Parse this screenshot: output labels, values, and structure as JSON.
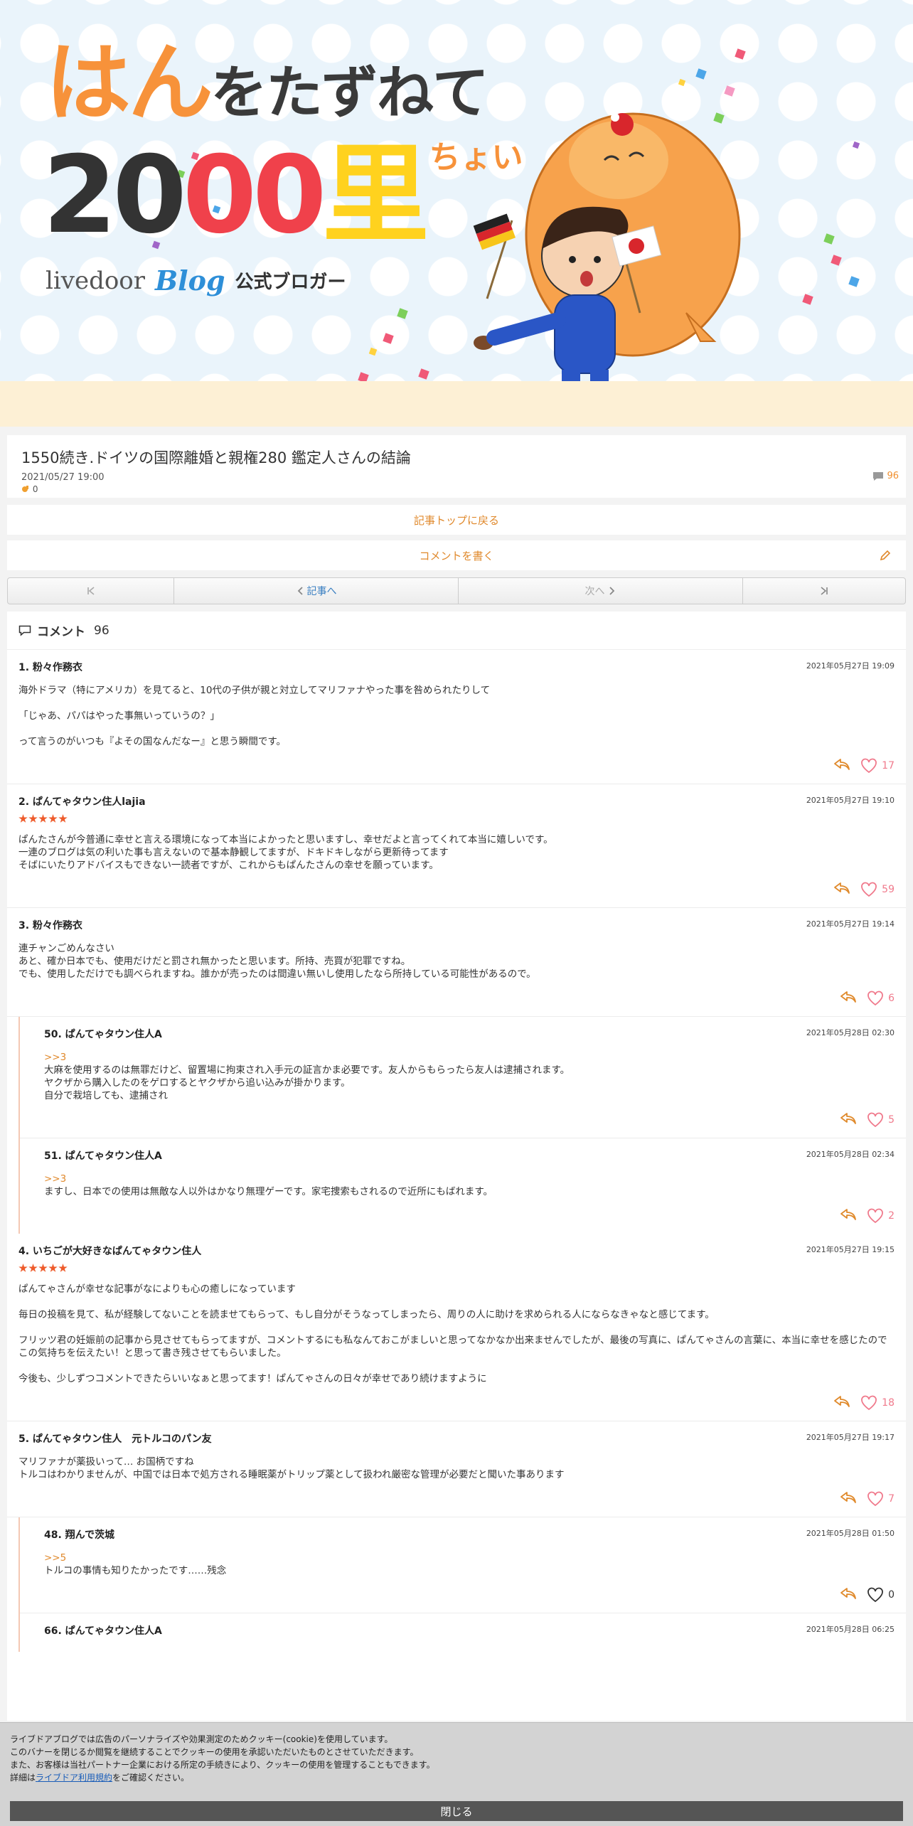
{
  "banner": {
    "title_a": "はん",
    "title_b": "をたずねて",
    "big_a": "20",
    "big_b": "00",
    "big_c": "里",
    "big_small": "ちょい",
    "logo_livedoor": "livedoor",
    "logo_blog": "Blog",
    "logo_official": "公式ブロガー"
  },
  "article": {
    "title": "1550続き.ドイツの国際離婚と親権280 鑑定人さんの結論",
    "date": "2021/05/27 19:00",
    "likes": "0",
    "comment_count": "96"
  },
  "links": {
    "back_to_top": "記事トップに戻る",
    "write_comment": "コメントを書く"
  },
  "pager": {
    "prev": "記事へ",
    "next": "次へ"
  },
  "comments_header": {
    "label": "コメント",
    "count": "96"
  },
  "comments": [
    {
      "name": "1.  粉々作務衣",
      "date": "2021年05月27日 19:09",
      "stars": false,
      "lines": [
        "海外ドラマ（特にアメリカ）を見てると、10代の子供が親と対立してマリファナやった事を咎められたりして",
        "",
        "「じゃあ、パパはやった事無いっていうの？」",
        "",
        "って言うのがいつも『よその国なんだなー』と思う瞬間です。"
      ],
      "likes": "17"
    },
    {
      "name": "2.  ぱんてゃタウン住人lajia",
      "date": "2021年05月27日 19:10",
      "stars": true,
      "lines": [
        "ぱんたさんが今普通に幸せと言える環境になって本当によかったと思いますし、幸せだよと言ってくれて本当に嬉しいです。",
        "一連のブログは気の利いた事も言えないので基本静観してますが、ドキドキしながら更新待ってます",
        "そばにいたりアドバイスもできない一読者ですが、これからもぱんたさんの幸せを願っています。"
      ],
      "likes": "59"
    },
    {
      "name": "3.  粉々作務衣",
      "date": "2021年05月27日 19:14",
      "stars": false,
      "lines": [
        "連チャンごめんなさい",
        "あと、確か日本でも、使用だけだと罰され無かったと思います。所持、売買が犯罪ですね。",
        "でも、使用しただけでも調べられますね。誰かが売ったのは間違い無いし使用したなら所持している可能性があるので。"
      ],
      "likes": "6",
      "replies": [
        {
          "name": "50.  ぱんてゃタウン住人A",
          "date": "2021年05月28日 02:30",
          "ref": ">>3",
          "lines": [
            "大麻を使用するのは無罪だけど、留置場に拘束され入手元の証言かま必要です。友人からもらったら友人は逮捕されます。",
            "ヤクザから購入したのをゲロするとヤクザから追い込みが掛かります。",
            "自分で栽培しても、逮捕され"
          ],
          "likes": "5"
        },
        {
          "name": "51.  ぱんてゃタウン住人A",
          "date": "2021年05月28日 02:34",
          "ref": ">>3",
          "lines": [
            "ますし、日本での使用は無敵な人以外はかなり無理ゲーです。家宅捜索もされるので近所にもばれます。"
          ],
          "likes": "2"
        }
      ]
    },
    {
      "name": "4.  いちごが大好きなぱんてゃタウン住人",
      "date": "2021年05月27日 19:15",
      "stars": true,
      "lines": [
        "ぱんてゃさんが幸せな記事がなによりも心の癒しになっています",
        "",
        "毎日の投稿を見て、私が経験してないことを読ませてもらって、もし自分がそうなってしまったら、周りの人に助けを求められる人にならなきゃなと感じてます。",
        "",
        "フリッツ君の妊娠前の記事から見させてもらってますが、コメントするにも私なんておこがましいと思ってなかなか出来ませんでしたが、最後の写真に、ぱんてゃさんの言葉に、本当に幸せを感じたのでこの気持ちを伝えたい！と思って書き残させてもらいました。",
        "",
        "今後も、少しずつコメントできたらいいなぁと思ってます！ぱんてゃさんの日々が幸せであり続けますように"
      ],
      "likes": "18"
    },
    {
      "name": "5.  ぱんてゃタウン住人　元トルコのパン友",
      "date": "2021年05月27日 19:17",
      "stars": false,
      "lines": [
        "マリファナが薬扱いって… お国柄ですね",
        "トルコはわかりませんが、中国では日本で処方される睡眠薬がトリップ薬として扱われ厳密な管理が必要だと聞いた事あります"
      ],
      "likes": "7",
      "replies": [
        {
          "name": "48.  翔んで茨城",
          "date": "2021年05月28日 01:50",
          "ref": ">>5",
          "lines": [
            "トルコの事情も知りたかったです……残念"
          ],
          "likes": "0",
          "zero": true
        },
        {
          "name": "66.  ぱんてゃタウン住人A",
          "date": "2021年05月28日 06:25",
          "ref": "",
          "lines": [],
          "likes": ""
        }
      ]
    }
  ],
  "cookie": {
    "line1": "ライブドアブログでは広告のパーソナライズや効果測定のためクッキー(cookie)を使用しています。",
    "line2": "このバナーを閉じるか閲覧を継続することでクッキーの使用を承認いただいたものとさせていただきます。",
    "line3": "また、お客様は当社パートナー企業における所定の手続きにより、クッキーの使用を管理することもできます。",
    "line4_pre": "詳細は",
    "line4_link": "ライブドア利用規約",
    "line4_post": "をご確認ください。",
    "close": "閉じる"
  },
  "colors": {
    "accent_orange": "#e0892c",
    "like_pink": "#f07a8c",
    "star_red": "#ee5b2b"
  },
  "icons": [
    "comment-bubble-icon",
    "pencil-icon",
    "first-page-icon",
    "chevron-left-icon",
    "chevron-right-icon",
    "last-page-icon",
    "reply-arrow-icon",
    "heart-icon",
    "like-hand-icon"
  ]
}
